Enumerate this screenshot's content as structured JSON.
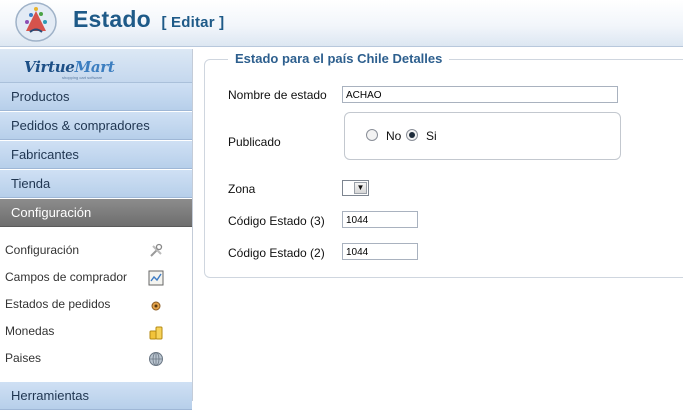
{
  "header": {
    "title": "Estado",
    "edit_label": "[ Editar ]"
  },
  "brand": {
    "name_part1": "Virtue",
    "name_part2": "Mart",
    "tagline": "shopping cart software"
  },
  "sidebar": {
    "nav": [
      {
        "label": "Productos"
      },
      {
        "label": "Pedidos & compradores"
      },
      {
        "label": "Fabricantes"
      },
      {
        "label": "Tienda"
      },
      {
        "label": "Configuración",
        "active": true
      }
    ],
    "sub_items": [
      {
        "label": "Configuración",
        "icon": "tools-icon"
      },
      {
        "label": "Campos de comprador",
        "icon": "form-fields-icon"
      },
      {
        "label": "Estados de pedidos",
        "icon": "order-status-icon"
      },
      {
        "label": "Monedas",
        "icon": "coins-icon"
      },
      {
        "label": "Paises",
        "icon": "globe-icon"
      }
    ],
    "bottom_nav": {
      "label": "Herramientas"
    }
  },
  "form": {
    "legend": "Estado para el país Chile Detalles",
    "state_name": {
      "label": "Nombre de estado",
      "value": "ACHAO"
    },
    "published": {
      "label": "Publicado",
      "options": [
        {
          "label": "No",
          "checked": false
        },
        {
          "label": "Si",
          "checked": true
        }
      ]
    },
    "zone": {
      "label": "Zona",
      "value": ""
    },
    "code3": {
      "label": "Código Estado (3)",
      "value": "1044"
    },
    "code2": {
      "label": "Código Estado (2)",
      "value": "1044"
    }
  },
  "colors": {
    "title": "#1e5a88",
    "nav_bg": "#c3d8ef",
    "nav_active_bg": "#7a7a7a",
    "legend": "#2d5f8e"
  }
}
